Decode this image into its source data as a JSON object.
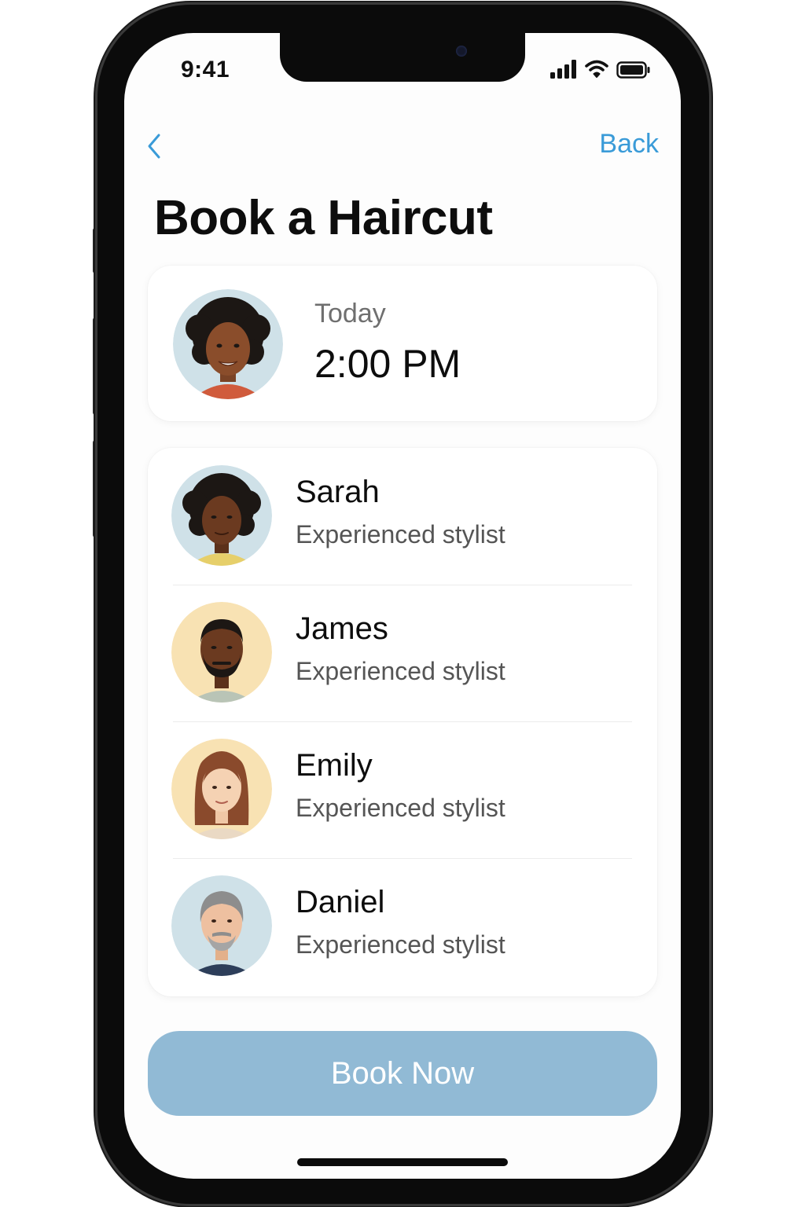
{
  "status_bar": {
    "time": "9:41"
  },
  "nav": {
    "back_label": "Back"
  },
  "page": {
    "title": "Book a Haircut"
  },
  "appointment": {
    "day": "Today",
    "time": "2:00 PM"
  },
  "stylists": [
    {
      "name": "Sarah",
      "subtitle": "Experienced stylist"
    },
    {
      "name": "James",
      "subtitle": "Experienced stylist"
    },
    {
      "name": "Emily",
      "subtitle": "Experienced stylist"
    },
    {
      "name": "Daniel",
      "subtitle": "Experienced stylist"
    }
  ],
  "action": {
    "book_label": "Book Now"
  },
  "colors": {
    "accent": "#3a9bd8",
    "button": "#91bad5"
  },
  "icons": [
    "back-chevron-icon",
    "signal-icon",
    "wifi-icon",
    "battery-icon"
  ]
}
